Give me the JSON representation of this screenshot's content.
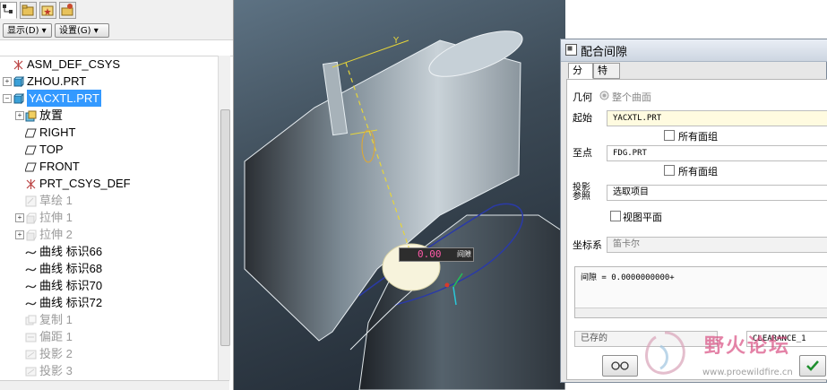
{
  "toolbar": {
    "tabs": [
      {
        "name": "model-tree-tab-icon"
      },
      {
        "name": "folder-browser-tab-icon"
      },
      {
        "name": "favorites-tab-icon"
      },
      {
        "name": "connections-tab-icon"
      }
    ],
    "show_label": "显示(D) ▾",
    "settings_label": "设置(G) ▾"
  },
  "tree": {
    "items": [
      {
        "label": "ASM_DEF_CSYS",
        "icon": "csys-icon",
        "indent": 0,
        "exp": "",
        "suppressed": false
      },
      {
        "label": "ZHOU.PRT",
        "icon": "part-icon",
        "indent": 0,
        "exp": "+",
        "suppressed": false
      },
      {
        "label": "YACXTL.PRT",
        "icon": "part-icon",
        "indent": 0,
        "exp": "−",
        "suppressed": false,
        "selected": true
      },
      {
        "label": "放置",
        "icon": "placement-icon",
        "indent": 1,
        "exp": "+",
        "suppressed": false
      },
      {
        "label": "RIGHT",
        "icon": "datum-plane-icon",
        "indent": 1,
        "exp": "",
        "suppressed": false
      },
      {
        "label": "TOP",
        "icon": "datum-plane-icon",
        "indent": 1,
        "exp": "",
        "suppressed": false
      },
      {
        "label": "FRONT",
        "icon": "datum-plane-icon",
        "indent": 1,
        "exp": "",
        "suppressed": false
      },
      {
        "label": "PRT_CSYS_DEF",
        "icon": "csys-icon",
        "indent": 1,
        "exp": "",
        "suppressed": false
      },
      {
        "label": "草绘 1",
        "icon": "sketch-icon",
        "indent": 1,
        "exp": "",
        "suppressed": true
      },
      {
        "label": "拉伸 1",
        "icon": "extrude-icon",
        "indent": 1,
        "exp": "+",
        "suppressed": true
      },
      {
        "label": "拉伸 2",
        "icon": "extrude-icon",
        "indent": 1,
        "exp": "+",
        "suppressed": true
      },
      {
        "label": "曲线 标识66",
        "icon": "curve-icon",
        "indent": 1,
        "exp": "",
        "suppressed": false
      },
      {
        "label": "曲线 标识68",
        "icon": "curve-icon",
        "indent": 1,
        "exp": "",
        "suppressed": false
      },
      {
        "label": "曲线 标识70",
        "icon": "curve-icon",
        "indent": 1,
        "exp": "",
        "suppressed": false
      },
      {
        "label": "曲线 标识72",
        "icon": "curve-icon",
        "indent": 1,
        "exp": "",
        "suppressed": false
      },
      {
        "label": "复制 1",
        "icon": "copy-icon",
        "indent": 1,
        "exp": "",
        "suppressed": true
      },
      {
        "label": "偏距 1",
        "icon": "offset-icon",
        "indent": 1,
        "exp": "",
        "suppressed": true
      },
      {
        "label": "投影 2",
        "icon": "project-icon",
        "indent": 1,
        "exp": "",
        "suppressed": true
      },
      {
        "label": "投影 3",
        "icon": "project-icon",
        "indent": 1,
        "exp": "",
        "suppressed": true
      }
    ]
  },
  "viewport": {
    "axis_label": "Y",
    "measure_value": "0.00",
    "measure_tag": "间隙"
  },
  "dialog": {
    "title": "配合间隙",
    "tabs": [
      "分析",
      "特征"
    ],
    "geometry_label": "几何",
    "geometry_option": "整个曲面",
    "start_label": "起始",
    "start_value": "YACXTL.PRT",
    "all_surfaces_1": "所有面组",
    "to_label": "至点",
    "to_value": "FDG.PRT",
    "all_surfaces_2": "所有面组",
    "projection_label_1": "投影",
    "projection_label_2": "参照",
    "projection_value": "选取项目",
    "view_plane_label": "视图平面",
    "coord_label": "坐标系",
    "coord_value": "笛卡尔",
    "result_text": "间隙 = 0.0000000000+",
    "saved_label": "已存的",
    "saved_value": "CLEARANCE_1",
    "colors": {
      "ok_green": "#1e8f2e",
      "title_bg": "#dbe3ec"
    }
  },
  "watermark": {
    "title": "野火论坛",
    "url": "www.proewildfire.cn"
  }
}
